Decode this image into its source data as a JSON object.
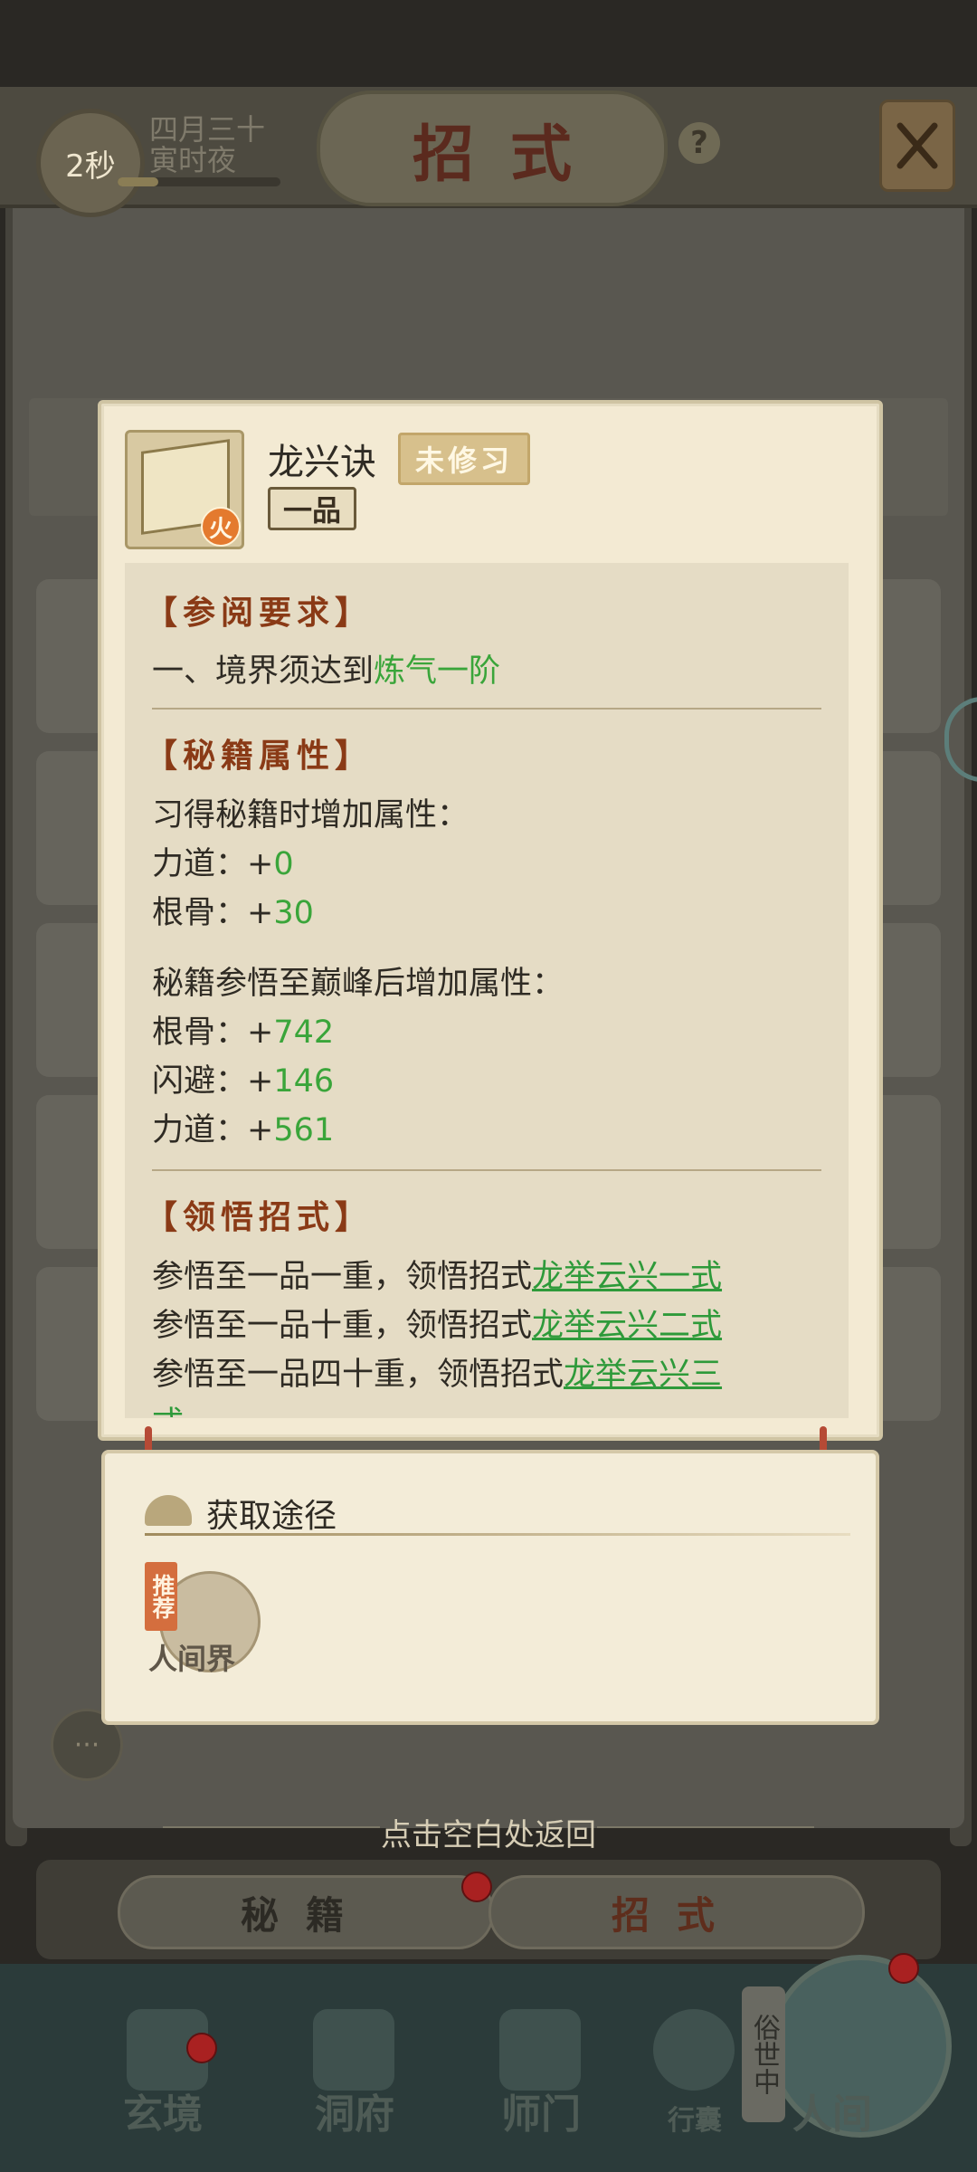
{
  "header": {
    "timer": "2秒",
    "date_line1": "四月三十",
    "date_line2": "寅时夜",
    "timer_progress": 0.25,
    "title": "招式",
    "help": "?"
  },
  "modal": {
    "item_name": "龙兴诀",
    "element": "火",
    "status": "未修习",
    "grade": "一品",
    "sections": {
      "requirement_title": "【参阅要求】",
      "requirement_text": "一、境界须达到",
      "requirement_value": "炼气一阶",
      "attributes_title": "【秘籍属性】",
      "learn_text": "习得秘籍时增加属性：",
      "learn_attrs": [
        {
          "label": "力道：+",
          "value": "0"
        },
        {
          "label": "根骨：+",
          "value": "30"
        }
      ],
      "peak_text": "秘籍参悟至巅峰后增加属性：",
      "peak_attrs": [
        {
          "label": "根骨：+",
          "value": "742"
        },
        {
          "label": "闪避：+",
          "value": "146"
        },
        {
          "label": "力道：+",
          "value": "561"
        }
      ],
      "moves_title": "【领悟招式】",
      "moves": [
        {
          "text": "参悟至一品一重，领悟招式",
          "link": "龙举云兴一式"
        },
        {
          "text": "参悟至一品十重，领悟招式",
          "link": "龙举云兴二式"
        },
        {
          "text": "参悟至一品四十重，领悟招式",
          "link": "龙举云兴三"
        }
      ],
      "overflow_char": "式"
    }
  },
  "obtain": {
    "title": "获取途径",
    "recommend": "推荐",
    "source": "人间界"
  },
  "return_hint": "点击空白处返回",
  "tabs": {
    "miji": "秘籍",
    "zhaoshi": "招式"
  },
  "nav": {
    "xuanjing": "玄境",
    "dongfu": "洞府",
    "shimen": "师门",
    "xingnang": "行囊",
    "renjian": "人间",
    "sushi": "俗世中"
  },
  "colors": {
    "accent_green": "#3aa53a",
    "section_title": "#8a3a16",
    "modal_bg": "#f3ead3"
  }
}
